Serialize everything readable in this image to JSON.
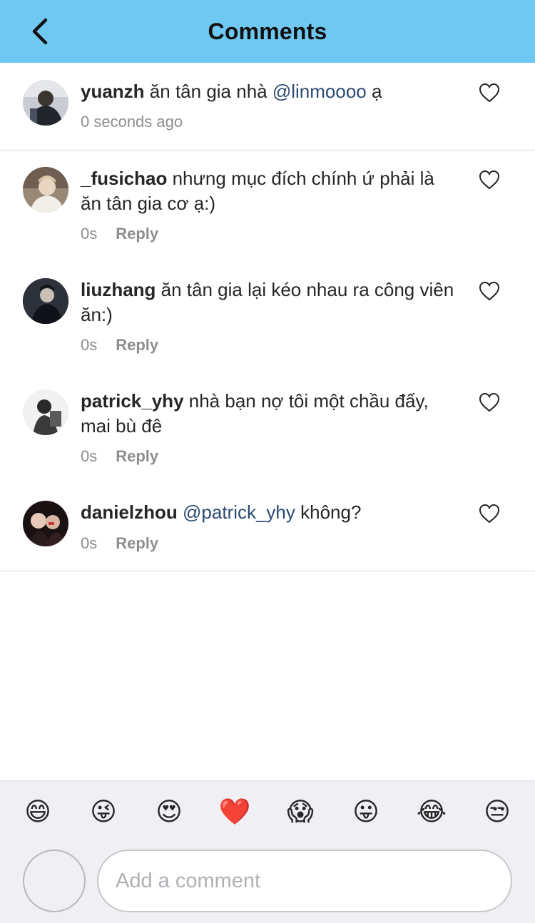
{
  "header": {
    "title": "Comments"
  },
  "caption": {
    "username": "yuanzh",
    "text": " ăn tân gia nhà ",
    "mention": "@linmoooo",
    "text_after": " ạ",
    "time": "0 seconds ago"
  },
  "comments": [
    {
      "username": "_fusichao",
      "text": " nhưng mục đích chính ứ phải là ăn tân gia cơ ạ:)",
      "time": "0s",
      "reply": "Reply"
    },
    {
      "username": "liuzhang",
      "text": " ăn tân gia lại kéo nhau ra công viên ăn:)",
      "time": "0s",
      "reply": "Reply"
    },
    {
      "username": "patrick_yhy",
      "text": " nhà bạn nợ tôi một chầu đấy, mai bù đê",
      "time": "0s",
      "reply": "Reply"
    },
    {
      "username": "danielzhou",
      "mention": " @patrick_yhy",
      "text": " không?",
      "time": "0s",
      "reply": "Reply"
    }
  ],
  "emojis": [
    "😄",
    "😜",
    "😍",
    "❤️",
    "😱",
    "😛",
    "😂",
    "😒"
  ],
  "composer": {
    "placeholder": "Add a comment"
  },
  "colors": {
    "header_bg": "#6fc8f2",
    "mention": "#2b4a73",
    "meta": "#8e8e8e",
    "bar_bg": "#efeff4"
  }
}
